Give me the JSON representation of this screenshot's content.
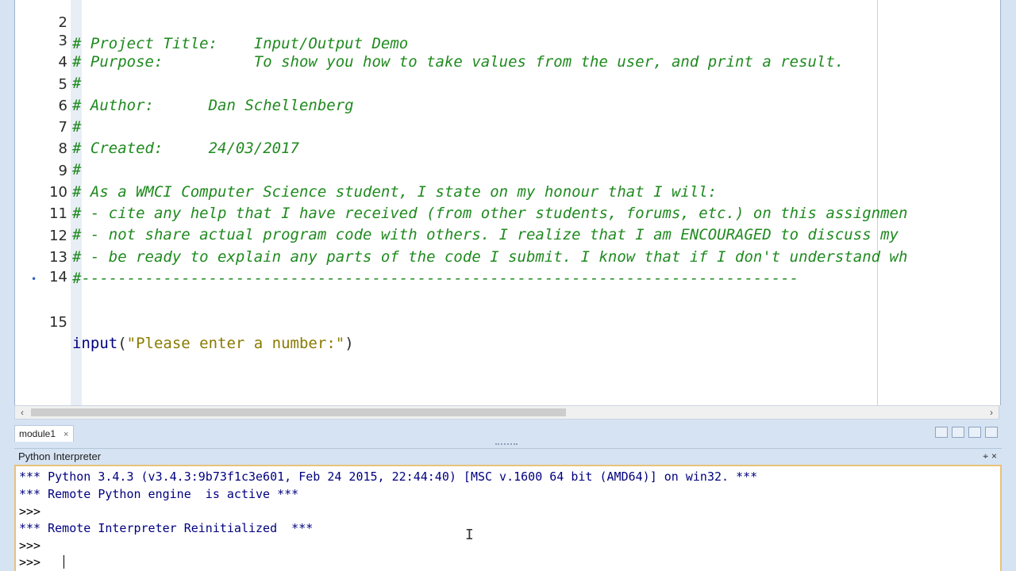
{
  "editor": {
    "lines": [
      {
        "num": "2",
        "text": "# Project Title:    Input/Output Demo",
        "kind": "comment"
      },
      {
        "num": "3",
        "text": "# Purpose:          To show you how to take values from the user, and print a result.",
        "kind": "comment"
      },
      {
        "num": "4",
        "text": "#",
        "kind": "comment"
      },
      {
        "num": "5",
        "text": "# Author:      Dan Schellenberg",
        "kind": "comment"
      },
      {
        "num": "6",
        "text": "#",
        "kind": "comment"
      },
      {
        "num": "7",
        "text": "# Created:     24/03/2017",
        "kind": "comment"
      },
      {
        "num": "8",
        "text": "#",
        "kind": "comment"
      },
      {
        "num": "9",
        "text": "# As a WMCI Computer Science student, I state on my honour that I will:",
        "kind": "comment"
      },
      {
        "num": "10",
        "text": "# - cite any help that I have received (from other students, forums, etc.) on this assignmen",
        "kind": "comment"
      },
      {
        "num": "11",
        "text": "# - not share actual program code with others. I realize that I am ENCOURAGED to discuss my",
        "kind": "comment"
      },
      {
        "num": "12",
        "text": "# - be ready to explain any parts of the code I submit. I know that if I don't understand wh",
        "kind": "comment"
      },
      {
        "num": "13",
        "text": "#-------------------------------------------------------------------------------",
        "kind": "comment"
      },
      {
        "num": "14",
        "text": "",
        "kind": "blank"
      },
      {
        "num": "15",
        "text": "",
        "kind": "code",
        "ident": "input",
        "open": "(",
        "string": "\"Please enter a number:\"",
        "close": ")"
      }
    ]
  },
  "doc_tab": {
    "label": "module1",
    "close": "×"
  },
  "interpreter": {
    "title": "Python Interpreter",
    "pin": "⌖",
    "close": "×",
    "lines": [
      "*** Python 3.4.3 (v3.4.3:9b73f1c3e601, Feb 24 2015, 22:44:40) [MSC v.1600 64 bit (AMD64)] on win32. ***",
      "*** Remote Python engine  is active ***",
      ">>>",
      "*** Remote Interpreter Reinitialized  ***",
      ">>>",
      ">>> "
    ]
  },
  "colors": {
    "comment": "#1f8a1f",
    "identifier": "#000080",
    "string": "#8a7a00",
    "focus_border": "#e8c27a"
  }
}
